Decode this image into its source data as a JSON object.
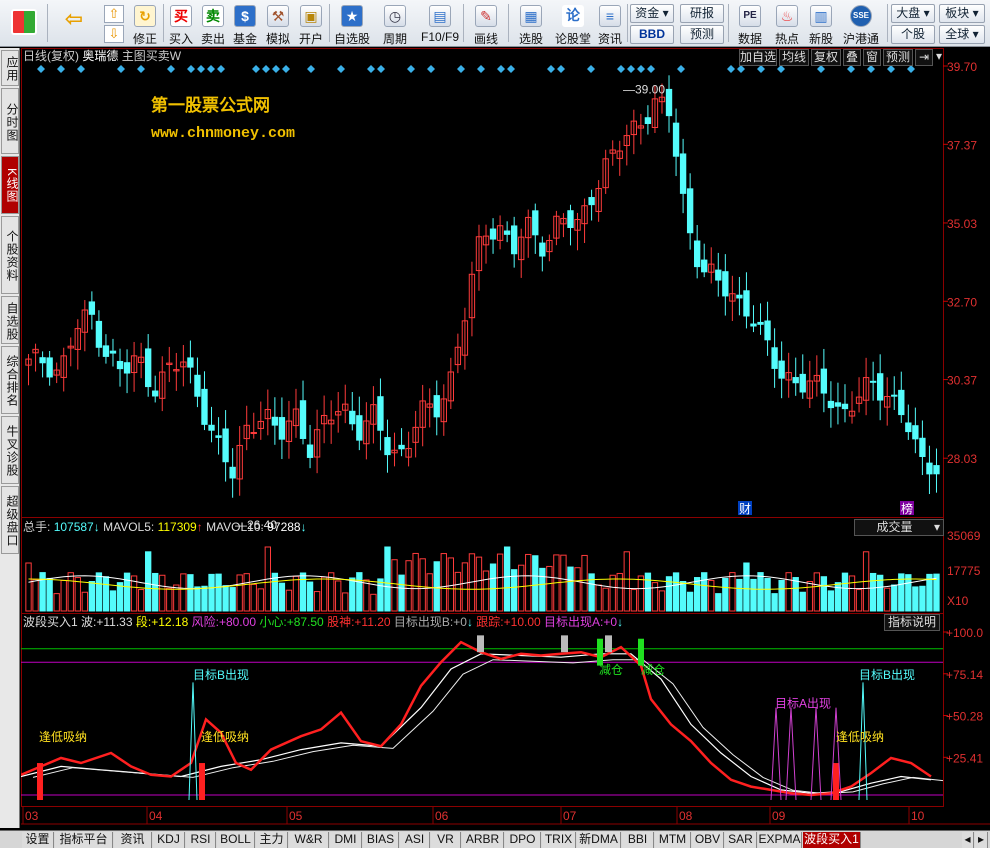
{
  "toolbar": {
    "items": [
      {
        "icon": "app-grid-icon",
        "label": ""
      },
      {
        "icon": "back-arrow-icon",
        "label": ""
      },
      {
        "icon": "up-down-arrow-icon",
        "label": ""
      },
      {
        "icon": "revise-icon",
        "label": "修正"
      },
      {
        "icon": "buy-icon",
        "glyph": "买",
        "label": "买入"
      },
      {
        "icon": "sell-icon",
        "glyph": "卖",
        "label": "卖出"
      },
      {
        "icon": "fund-icon",
        "glyph": "$",
        "label": "基金"
      },
      {
        "icon": "hammer-icon",
        "glyph": "⚒",
        "label": "模拟"
      },
      {
        "icon": "lock-icon",
        "glyph": "🔒",
        "label": "开户"
      },
      {
        "icon": "watchlist-icon",
        "glyph": "★",
        "label": "自选股"
      },
      {
        "icon": "clock-icon",
        "glyph": "◷",
        "label": "周期"
      },
      {
        "icon": "f10-icon",
        "glyph": "▤",
        "label": "F10/F9"
      },
      {
        "icon": "pencil-icon",
        "glyph": "✎",
        "label": "画线"
      },
      {
        "icon": "screener-icon",
        "glyph": "▦",
        "label": "选股"
      },
      {
        "icon": "forum-icon",
        "glyph": "论",
        "label": "论股堂"
      },
      {
        "icon": "info-icon",
        "glyph": "≡",
        "label": "资讯"
      }
    ],
    "small_buttons": {
      "capital": "资金",
      "bbd": "BBD",
      "research": "研报",
      "forecast": "预测"
    },
    "right_items": [
      {
        "icon": "pe-icon",
        "glyph": "PE",
        "label": "数据"
      },
      {
        "icon": "hot-icon",
        "glyph": "♨",
        "label": "热点"
      },
      {
        "icon": "newstock-icon",
        "glyph": "▥",
        "label": "新股"
      },
      {
        "icon": "hk-connect-icon",
        "glyph": "SSE",
        "label": "沪港通"
      }
    ],
    "dropdowns": {
      "market": "大盘",
      "sector": "板块",
      "stock": "个股",
      "global": "全球"
    }
  },
  "left_tabs": [
    "应用",
    "分时图",
    "K线图",
    "个股资料",
    "自选股",
    "综合排名",
    "牛叉诊股",
    "超级盘口"
  ],
  "left_tab_active": 2,
  "kline_header": {
    "period": "日线(复权)",
    "stock": "奥瑞德",
    "formula": "主图买卖W",
    "buttons": [
      "加自选",
      "均线",
      "复权",
      "叠",
      "窗",
      "预测"
    ],
    "watermark_cn": "第一股票公式网",
    "watermark_url": "www.chnmoney.com"
  },
  "price_axis": [
    "39.70",
    "37.37",
    "35.03",
    "32.70",
    "30.37",
    "28.03"
  ],
  "price_annotations": {
    "high": "39.00",
    "low": "26.40",
    "cai": "财",
    "bang": "榜"
  },
  "volume_header": {
    "total_label": "总手:",
    "total": "107587",
    "mavol5_label": "MAVOL5:",
    "mavol5": "117309",
    "mavol10_label": "MAVOL10:",
    "mavol10": "97288",
    "selector": "成交量"
  },
  "volume_axis": [
    "35069",
    "17775",
    "X10"
  ],
  "indicator_header": {
    "name": "波段买入1",
    "wave_label": "波:",
    "wave": "+11.33",
    "seg_label": "段:",
    "seg": "+12.18",
    "risk_label": "风险:",
    "risk": "+80.00",
    "care_label": "小心:",
    "care": "+87.50",
    "god_label": "股神:",
    "god": "+11.20",
    "targetb_label": "目标出现B:",
    "targetb": "+0",
    "track_label": "跟踪:",
    "track": "+10.00",
    "targeta_label": "目标出现A:",
    "targeta": "+0",
    "explain_button": "指标说明"
  },
  "indicator_axis": [
    "+100.0",
    "+75.14",
    "+50.28",
    "+25.41"
  ],
  "indicator_labels": {
    "low_buy": "逢低吸纳",
    "target_b": "目标B出现",
    "reduce": "减仓",
    "overlap": "目标A出现"
  },
  "months": [
    "03",
    "04",
    "05",
    "06",
    "07",
    "08",
    "09",
    "10"
  ],
  "bottom_tabs": [
    "设置",
    "指标平台",
    "资讯",
    "KDJ",
    "RSI",
    "BOLL",
    "主力",
    "W&R",
    "DMI",
    "BIAS",
    "ASI",
    "VR",
    "ARBR",
    "DPO",
    "TRIX",
    "新DMA",
    "BBI",
    "MTM",
    "OBV",
    "SAR",
    "EXPMA",
    "波段买入1"
  ],
  "bottom_tab_active": 21,
  "colors": {
    "up": "#ff3b3b",
    "down": "#54fcfc",
    "ma_white": "#ffffff",
    "ma_yellow": "#ffff00",
    "indicator_red": "#ff2020",
    "green_line": "#00c000",
    "magenta_line": "#c000c0",
    "grid": "#8b0000"
  },
  "chart_data": {
    "type": "candlestick",
    "x": [
      "03",
      "04",
      "05",
      "06",
      "07",
      "08",
      "09",
      "10"
    ],
    "ylim": [
      26.4,
      39.7
    ],
    "high": 39.0,
    "low": 26.4,
    "close_path": [
      30.8,
      31.0,
      30.6,
      31.8,
      32.3,
      31.2,
      30.5,
      31.0,
      30.2,
      30.6,
      30.9,
      29.8,
      28.4,
      27.5,
      29.1,
      29.3,
      28.6,
      29.5,
      28.3,
      29.0,
      29.8,
      28.8,
      29.2,
      28.4,
      28.2,
      29.3,
      29.5,
      30.5,
      32.5,
      34.8,
      35.0,
      34.2,
      34.9,
      34.4,
      35.2,
      34.8,
      36.0,
      36.8,
      37.4,
      38.1,
      38.6,
      38.2,
      35.2,
      33.7,
      33.2,
      32.9,
      32.5,
      31.4,
      30.6,
      30.4,
      30.1,
      30.0,
      29.4,
      29.8,
      30.2,
      30.0,
      29.2,
      27.8,
      27.9
    ]
  }
}
